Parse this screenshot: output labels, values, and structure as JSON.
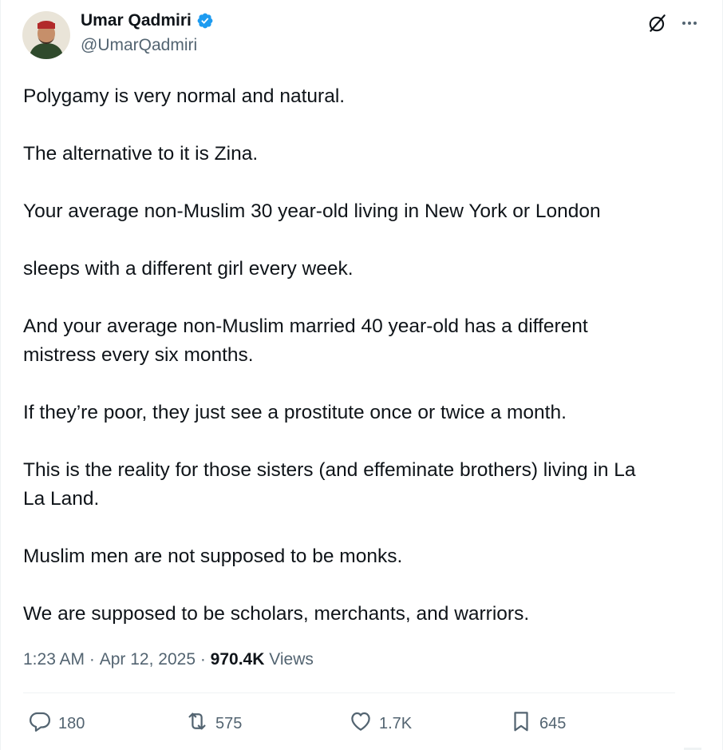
{
  "author": {
    "display_name": "Umar Qadmiri",
    "handle": "@UmarQadmiri",
    "verified_badge_icon": "verified-badge-icon",
    "badge_color": "#1d9bf0"
  },
  "header_icons": {
    "grok": "grok-icon",
    "more": "more-options-icon"
  },
  "post": {
    "paragraphs": [
      "Polygamy is very normal and natural.",
      "The alternative to it is Zina.",
      "Your average non-Muslim 30 year-old living in New York or London",
      "sleeps with a different girl every week.",
      "And your average non-Muslim married 40 year-old has a different\nmistress every six months.",
      "If they’re poor, they just see a prostitute once or twice a month.",
      "This is the reality for those sisters (and effeminate brothers) living in La\nLa Land.",
      "Muslim men are not supposed to be monks.",
      "We are supposed to be scholars, merchants, and warriors."
    ]
  },
  "meta": {
    "time": "1:23 AM",
    "separator": " · ",
    "date": "Apr 12, 2025",
    "views_count": "970.4K",
    "views_label": " Views"
  },
  "actions": {
    "replies": {
      "icon": "reply-icon",
      "count": "180"
    },
    "reposts": {
      "icon": "repost-icon",
      "count": "575"
    },
    "likes": {
      "icon": "heart-icon",
      "count": "1.7K"
    },
    "bookmarks": {
      "icon": "bookmark-icon",
      "count": "645"
    }
  },
  "colors": {
    "text_primary": "#0f1419",
    "text_secondary": "#536471",
    "divider": "#eff3f4"
  }
}
